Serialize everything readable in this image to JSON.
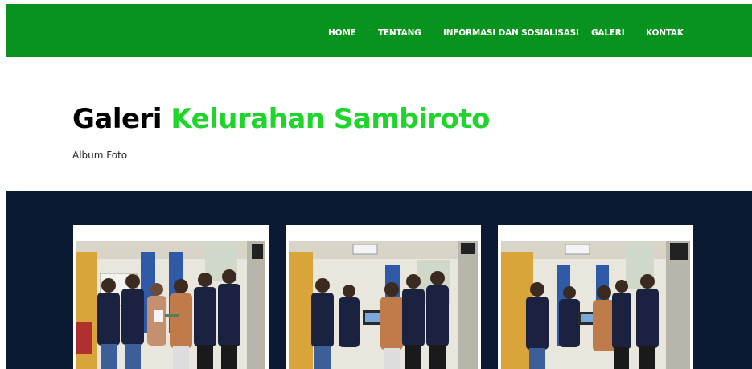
{
  "nav": {
    "items": [
      {
        "label": "HOME"
      },
      {
        "label": "TENTANG"
      },
      {
        "label": "INFORMASI DAN SOSIALISASI"
      },
      {
        "label": "GALERI"
      },
      {
        "label": "KONTAK"
      }
    ]
  },
  "hero": {
    "title_part1": "Galeri",
    "title_part2": "Kelurahan Sambiroto",
    "subtitle": "Album Foto"
  },
  "gallery": {
    "photos": [
      {
        "alt": "photo-1"
      },
      {
        "alt": "photo-2"
      },
      {
        "alt": "photo-3"
      }
    ]
  },
  "colors": {
    "nav_bg": "#08921e",
    "accent_green": "#1fd52b",
    "gallery_bg": "#0a1a33"
  }
}
